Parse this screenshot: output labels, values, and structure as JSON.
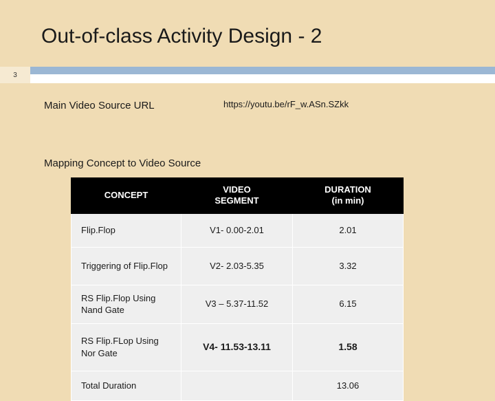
{
  "slide": {
    "title": "Out-of-class Activity Design - 2",
    "number": "3",
    "main_video_label": "Main Video Source URL",
    "main_video_url": "https://youtu.be/rF_w.ASn.SZkk",
    "mapping_label": "Mapping Concept to Video Source"
  },
  "table": {
    "headers": [
      "CONCEPT",
      "VIDEO SEGMENT",
      "DURATION (in min)"
    ],
    "header_lines": [
      [
        "CONCEPT"
      ],
      [
        "VIDEO",
        "SEGMENT"
      ],
      [
        "DURATION",
        "(in min)"
      ]
    ],
    "rows": [
      {
        "concept": "Flip.Flop",
        "segment": "V1- 0.00-2.01",
        "duration": "2.01"
      },
      {
        "concept": "Triggering of Flip.Flop",
        "segment": "V2- 2.03-5.35",
        "duration": "3.32"
      },
      {
        "concept": "RS Flip.Flop Using Nand Gate",
        "segment": "V3 – 5.37-11.52",
        "duration": "6.15"
      },
      {
        "concept": "RS Flip.FLop Using Nor Gate",
        "segment": "V4- 11.53-13.11",
        "duration": "1.58"
      },
      {
        "concept": "Total Duration",
        "segment": "",
        "duration": "13.06"
      }
    ]
  },
  "colors": {
    "background": "#f0dcb4",
    "header_band": "#9bb7d4",
    "table_header_bg": "#000000",
    "table_cell_bg": "#efefef"
  }
}
